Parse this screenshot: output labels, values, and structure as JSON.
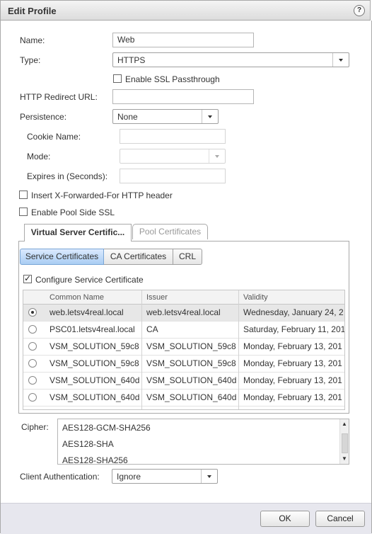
{
  "dialog": {
    "title": "Edit Profile",
    "help_label": "?"
  },
  "form": {
    "name_label": "Name:",
    "name_value": "Web",
    "type_label": "Type:",
    "type_value": "HTTPS",
    "ssl_passthrough_label": "Enable SSL Passthrough",
    "ssl_passthrough_checked": false,
    "redirect_label": "HTTP Redirect URL:",
    "redirect_value": "",
    "persistence_label": "Persistence:",
    "persistence_value": "None",
    "cookie_label": "Cookie Name:",
    "mode_label": "Mode:",
    "expires_label": "Expires in (Seconds):",
    "xff_label": "Insert X-Forwarded-For HTTP header",
    "xff_checked": false,
    "pool_ssl_label": "Enable Pool Side SSL",
    "pool_ssl_checked": false
  },
  "tabs": {
    "virtual_server": "Virtual Server Certific...",
    "pool": "Pool Certificates"
  },
  "subtabs": {
    "service": "Service Certificates",
    "ca": "CA Certificates",
    "crl": "CRL"
  },
  "certs": {
    "configure_label": "Configure Service Certificate",
    "configure_checked": true,
    "columns": [
      "Common Name",
      "Issuer",
      "Validity"
    ],
    "rows": [
      {
        "name": "web.letsv4real.local",
        "issuer": "web.letsv4real.local",
        "validity": "Wednesday, January 24, 2",
        "selected": true
      },
      {
        "name": "PSC01.letsv4real.local",
        "issuer": "CA",
        "validity": "Saturday, February 11, 201",
        "selected": false
      },
      {
        "name": "VSM_SOLUTION_59c8",
        "issuer": "VSM_SOLUTION_59c8",
        "validity": "Monday, February 13, 201",
        "selected": false
      },
      {
        "name": "VSM_SOLUTION_59c8",
        "issuer": "VSM_SOLUTION_59c8",
        "validity": "Monday, February 13, 201",
        "selected": false
      },
      {
        "name": "VSM_SOLUTION_640d",
        "issuer": "VSM_SOLUTION_640d",
        "validity": "Monday, February 13, 201",
        "selected": false
      },
      {
        "name": "VSM_SOLUTION_640d",
        "issuer": "VSM_SOLUTION_640d",
        "validity": "Monday, February 13, 201",
        "selected": false
      }
    ]
  },
  "cipher": {
    "label": "Cipher:",
    "items": [
      "AES128-GCM-SHA256",
      "AES128-SHA",
      "AES128-SHA256"
    ]
  },
  "client_auth": {
    "label": "Client Authentication:",
    "value": "Ignore"
  },
  "buttons": {
    "ok": "OK",
    "cancel": "Cancel"
  }
}
